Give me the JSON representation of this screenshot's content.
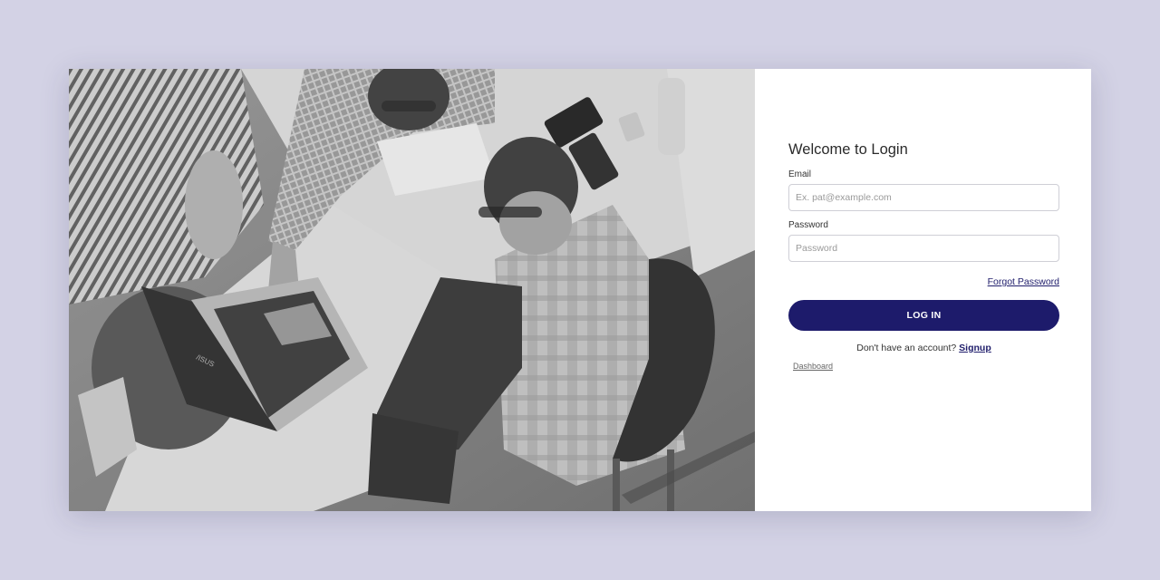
{
  "photo": {
    "alt": "Group of people working around a table with a laptop (grayscale)",
    "laptop_brand": "/ISUS"
  },
  "login": {
    "title": "Welcome to Login",
    "email_label": "Email",
    "email_placeholder": "Ex. pat@example.com",
    "email_value": "",
    "password_label": "Password",
    "password_placeholder": "Password",
    "password_value": "",
    "forgot_label": "Forgot Password",
    "submit_label": "LOG IN",
    "signup_prompt": "Don't have an account?",
    "signup_label": "Signup",
    "dashboard_label": "Dashboard"
  },
  "colors": {
    "page_background": "#d3d2e5",
    "accent": "#1d1b6b",
    "panel_background": "#ffffff"
  }
}
